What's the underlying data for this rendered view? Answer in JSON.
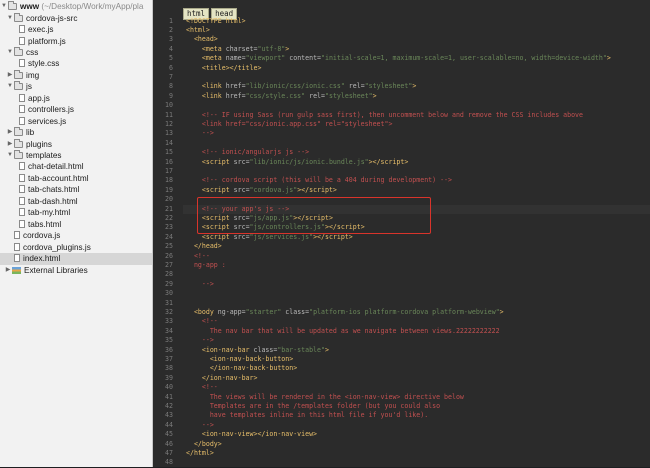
{
  "sidebar": {
    "root": {
      "name": "www",
      "path": "(~/Desktop/Work/myApp/pla"
    },
    "items": [
      {
        "label": "cordova-js-src",
        "kind": "folder",
        "expanded": true,
        "level": 1
      },
      {
        "label": "exec.js",
        "kind": "file",
        "level": 2
      },
      {
        "label": "platform.js",
        "kind": "file",
        "level": 2
      },
      {
        "label": "css",
        "kind": "folder",
        "expanded": true,
        "level": 1
      },
      {
        "label": "style.css",
        "kind": "file",
        "level": 2
      },
      {
        "label": "img",
        "kind": "folder",
        "expanded": false,
        "level": 1
      },
      {
        "label": "js",
        "kind": "folder",
        "expanded": true,
        "level": 1
      },
      {
        "label": "app.js",
        "kind": "file",
        "level": 2
      },
      {
        "label": "controllers.js",
        "kind": "file",
        "level": 2
      },
      {
        "label": "services.js",
        "kind": "file",
        "level": 2
      },
      {
        "label": "lib",
        "kind": "folder",
        "expanded": false,
        "level": 1
      },
      {
        "label": "plugins",
        "kind": "folder",
        "expanded": false,
        "level": 1
      },
      {
        "label": "templates",
        "kind": "folder",
        "expanded": true,
        "level": 1
      },
      {
        "label": "chat-detail.html",
        "kind": "file",
        "level": 2
      },
      {
        "label": "tab-account.html",
        "kind": "file",
        "level": 2
      },
      {
        "label": "tab-chats.html",
        "kind": "file",
        "level": 2
      },
      {
        "label": "tab-dash.html",
        "kind": "file",
        "level": 2
      },
      {
        "label": "tab-my.html",
        "kind": "file",
        "level": 2
      },
      {
        "label": "tabs.html",
        "kind": "file",
        "level": 2
      },
      {
        "label": "cordova.js",
        "kind": "file",
        "level": 1
      },
      {
        "label": "cordova_plugins.js",
        "kind": "file",
        "level": 1
      },
      {
        "label": "index.html",
        "kind": "file",
        "level": 1,
        "selected": true
      },
      {
        "label": "External Libraries",
        "kind": "lib",
        "level": 0
      }
    ]
  },
  "editor": {
    "breadcrumb": [
      "html",
      "head"
    ],
    "lines": [
      {
        "n": "1",
        "html": "<span class=\"t\">&lt;!DOCTYPE html&gt;</span>"
      },
      {
        "n": "2",
        "html": "<span class=\"t\">&lt;html&gt;</span>"
      },
      {
        "n": "3",
        "html": "  <span class=\"t\">&lt;head&gt;</span>"
      },
      {
        "n": "4",
        "html": "    <span class=\"t\">&lt;meta </span><span class=\"a\">charset=</span><span class=\"v\">\"utf-8\"</span><span class=\"t\">&gt;</span>"
      },
      {
        "n": "5",
        "html": "    <span class=\"t\">&lt;meta </span><span class=\"a\">name=</span><span class=\"v\">\"viewport\" </span><span class=\"a\">content=</span><span class=\"v\">\"initial-scale=1, maximum-scale=1, user-scalable=no, width=device-width\"</span><span class=\"t\">&gt;</span>"
      },
      {
        "n": "6",
        "html": "    <span class=\"t\">&lt;title&gt;&lt;/title&gt;</span>"
      },
      {
        "n": "7",
        "html": ""
      },
      {
        "n": "8",
        "html": "    <span class=\"t\">&lt;link </span><span class=\"a\">href=</span><span class=\"v\">\"lib/ionic/css/ionic.css\" </span><span class=\"a\">rel=</span><span class=\"v\">\"stylesheet\"</span><span class=\"t\">&gt;</span>"
      },
      {
        "n": "9",
        "html": "    <span class=\"t\">&lt;link </span><span class=\"a\">href=</span><span class=\"v\">\"css/style.css\" </span><span class=\"a\">rel=</span><span class=\"v\">\"stylesheet\"</span><span class=\"t\">&gt;</span>"
      },
      {
        "n": "10",
        "html": ""
      },
      {
        "n": "11",
        "html": "    <span class=\"c\">&lt;!-- IF using Sass (run gulp sass first), then uncomment below and remove the CSS includes above</span>"
      },
      {
        "n": "12",
        "html": "    <span class=\"c\">&lt;link href=\"css/ionic.app.css\" rel=\"stylesheet\"&gt;</span>"
      },
      {
        "n": "13",
        "html": "    <span class=\"c\">--&gt;</span>"
      },
      {
        "n": "14",
        "html": ""
      },
      {
        "n": "15",
        "html": "    <span class=\"c\">&lt;!-- ionic/angularjs js --&gt;</span>"
      },
      {
        "n": "16",
        "html": "    <span class=\"t\">&lt;script </span><span class=\"a\">src=</span><span class=\"v\">\"lib/ionic/js/ionic.bundle.js\"</span><span class=\"t\">&gt;&lt;/script&gt;</span>"
      },
      {
        "n": "17",
        "html": ""
      },
      {
        "n": "18",
        "html": "    <span class=\"c\">&lt;!-- cordova script (this will be a 404 during development) --&gt;</span>"
      },
      {
        "n": "19",
        "html": "    <span class=\"t\">&lt;script </span><span class=\"a\">src=</span><span class=\"v\">\"cordova.js\"</span><span class=\"t\">&gt;&lt;/script&gt;</span>"
      },
      {
        "n": "20",
        "html": ""
      },
      {
        "n": "21",
        "html": "    <span class=\"c\">&lt;!-- your app's js --&gt;</span>"
      },
      {
        "n": "22",
        "html": "    <span class=\"t\">&lt;script </span><span class=\"a\">src=</span><span class=\"v\">\"js/app.js\"</span><span class=\"t\">&gt;&lt;/script&gt;</span>"
      },
      {
        "n": "23",
        "html": "    <span class=\"t\">&lt;script </span><span class=\"a\">src=</span><span class=\"v\">\"js/controllers.js\"</span><span class=\"t\">&gt;&lt;/script&gt;</span>"
      },
      {
        "n": "24",
        "html": "    <span class=\"t\">&lt;script </span><span class=\"a\">src=</span><span class=\"v\">\"js/services.js\"</span><span class=\"t\">&gt;&lt;/script&gt;</span>"
      },
      {
        "n": "25",
        "html": "  <span class=\"t\">&lt;/head&gt;</span>"
      },
      {
        "n": "26",
        "html": "  <span class=\"c\">&lt;!--</span>"
      },
      {
        "n": "27",
        "html": "  <span class=\"c\">ng-app :</span>"
      },
      {
        "n": "28",
        "html": ""
      },
      {
        "n": "29",
        "html": "    <span class=\"c\">--&gt;</span>"
      },
      {
        "n": "30",
        "html": ""
      },
      {
        "n": "31",
        "html": ""
      },
      {
        "n": "32",
        "html": "  <span class=\"t\">&lt;body </span><span class=\"a\">ng-app=</span><span class=\"v\">\"starter\" </span><span class=\"a\">class=</span><span class=\"v\">\"platform-ios platform-cordova platform-webview\"</span><span class=\"t\">&gt;</span>"
      },
      {
        "n": "33",
        "html": "    <span class=\"c\">&lt;!--</span>"
      },
      {
        "n": "34",
        "html": "      <span class=\"c\">The nav bar that will be updated as we navigate between views.22222222222</span>"
      },
      {
        "n": "35",
        "html": "    <span class=\"c\">--&gt;</span>"
      },
      {
        "n": "36",
        "html": "    <span class=\"t\">&lt;ion-nav-bar </span><span class=\"a\">class=</span><span class=\"v\">\"bar-stable\"</span><span class=\"t\">&gt;</span>"
      },
      {
        "n": "37",
        "html": "      <span class=\"t\">&lt;ion-nav-back-button&gt;</span>"
      },
      {
        "n": "38",
        "html": "      <span class=\"t\">&lt;/ion-nav-back-button&gt;</span>"
      },
      {
        "n": "39",
        "html": "    <span class=\"t\">&lt;/ion-nav-bar&gt;</span>"
      },
      {
        "n": "40",
        "html": "    <span class=\"c\">&lt;!--</span>"
      },
      {
        "n": "41",
        "html": "      <span class=\"c\">The views will be rendered in the &lt;ion-nav-view&gt; directive below</span>"
      },
      {
        "n": "42",
        "html": "      <span class=\"c\">Templates are in the /templates folder (but you could also</span>"
      },
      {
        "n": "43",
        "html": "      <span class=\"c\">have templates inline in this html file if you'd like).</span>"
      },
      {
        "n": "44",
        "html": "    <span class=\"c\">--&gt;</span>"
      },
      {
        "n": "45",
        "html": "    <span class=\"t\">&lt;ion-nav-view&gt;&lt;/ion-nav-view&gt;</span>"
      },
      {
        "n": "46",
        "html": "  <span class=\"t\">&lt;/body&gt;</span>"
      },
      {
        "n": "47",
        "html": "<span class=\"t\">&lt;/html&gt;</span>"
      },
      {
        "n": "48",
        "html": ""
      }
    ]
  },
  "colors": {
    "highlight_box": "#d9342b",
    "editor_bg": "#2b2b2b",
    "tag": "#e8bf6a",
    "string": "#6a8759",
    "comment": "#c25050"
  }
}
